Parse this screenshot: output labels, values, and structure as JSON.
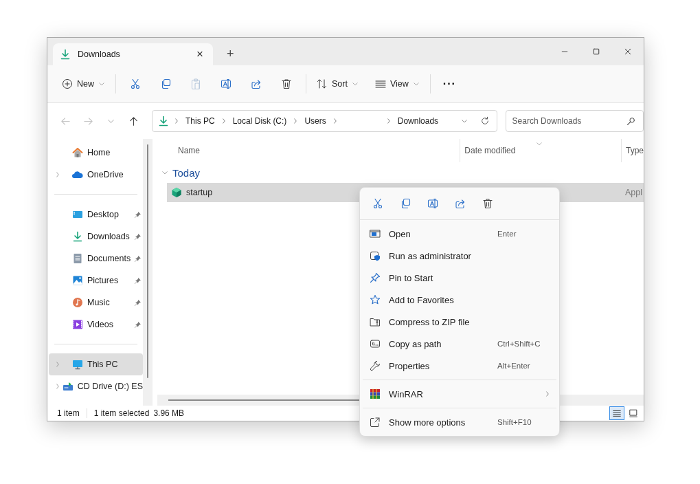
{
  "window": {
    "tab_title": "Downloads",
    "tab_close": "×",
    "new_tab": "+"
  },
  "toolbar": {
    "new_label": "New",
    "sort_label": "Sort",
    "view_label": "View",
    "more": "···",
    "actions": [
      {
        "kind": "cut",
        "disabled": false
      },
      {
        "kind": "copy",
        "disabled": false
      },
      {
        "kind": "paste",
        "disabled": true
      },
      {
        "kind": "rename",
        "disabled": false
      },
      {
        "kind": "share",
        "disabled": false
      },
      {
        "kind": "delete",
        "disabled": false
      }
    ]
  },
  "navigation": [
    {
      "kind": "back",
      "disabled": true
    },
    {
      "kind": "forward",
      "disabled": true
    },
    {
      "kind": "recent",
      "disabled": true
    },
    {
      "kind": "up",
      "disabled": false
    }
  ],
  "address": {
    "segments": [
      {
        "kind": "text",
        "label": "This PC"
      },
      {
        "kind": "text",
        "label": "Local Disk (C:)"
      },
      {
        "kind": "text",
        "label": "Users"
      },
      {
        "kind": "blank"
      },
      {
        "kind": "text",
        "label": "Downloads"
      }
    ]
  },
  "search": {
    "placeholder": "Search Downloads"
  },
  "sidebar": {
    "groups": [
      [
        {
          "label": "Home",
          "kind": "home",
          "pinned": false,
          "expandable": false,
          "selected": false
        },
        {
          "label": "OneDrive",
          "kind": "cloud",
          "pinned": false,
          "expandable": true,
          "selected": false
        }
      ],
      [
        {
          "label": "Desktop",
          "kind": "desktop",
          "pinned": true,
          "expandable": false,
          "selected": false
        },
        {
          "label": "Downloads",
          "kind": "download",
          "pinned": true,
          "expandable": false,
          "selected": false
        },
        {
          "label": "Documents",
          "kind": "document",
          "pinned": true,
          "expandable": false,
          "selected": false
        },
        {
          "label": "Pictures",
          "kind": "picture",
          "pinned": true,
          "expandable": false,
          "selected": false
        },
        {
          "label": "Music",
          "kind": "music",
          "pinned": true,
          "expandable": false,
          "selected": false
        },
        {
          "label": "Videos",
          "kind": "video",
          "pinned": true,
          "expandable": false,
          "selected": false
        }
      ],
      [
        {
          "label": "This PC",
          "kind": "pc",
          "pinned": false,
          "expandable": true,
          "selected": true
        },
        {
          "label": "CD Drive (D:) ES",
          "kind": "cd",
          "pinned": false,
          "expandable": true,
          "selected": false
        }
      ]
    ]
  },
  "file_list": {
    "columns": [
      "Name",
      "Date modified",
      "Type"
    ],
    "groups": [
      {
        "label": "Today",
        "expanded": true,
        "rows": [
          {
            "name": "startup",
            "type": "Appl",
            "selected": true
          }
        ]
      }
    ]
  },
  "status_bar": {
    "count": "1 item",
    "selection": "1 item selected",
    "size": "3.96 MB",
    "views": [
      {
        "kind": "details",
        "selected": true
      },
      {
        "kind": "tiles",
        "selected": false
      }
    ]
  },
  "context_menu": {
    "quick_actions": [
      {
        "kind": "cut"
      },
      {
        "kind": "copy"
      },
      {
        "kind": "rename"
      },
      {
        "kind": "share"
      },
      {
        "kind": "delete"
      }
    ],
    "groups": [
      [
        {
          "label": "Open",
          "kind": "open",
          "shortcut": "Enter",
          "submenu": false
        },
        {
          "label": "Run as administrator",
          "kind": "shield",
          "submenu": false
        },
        {
          "label": "Pin to Start",
          "kind": "pin",
          "submenu": false
        },
        {
          "label": "Add to Favorites",
          "kind": "star",
          "submenu": false
        },
        {
          "label": "Compress to ZIP file",
          "kind": "zip",
          "submenu": false
        },
        {
          "label": "Copy as path",
          "kind": "path",
          "shortcut": "Ctrl+Shift+C",
          "submenu": false
        },
        {
          "label": "Properties",
          "kind": "wrench",
          "shortcut": "Alt+Enter",
          "submenu": false
        }
      ],
      [
        {
          "label": "WinRAR",
          "kind": "winrar",
          "submenu": true
        }
      ],
      [
        {
          "label": "Show more options",
          "kind": "more",
          "shortcut": "Shift+F10",
          "submenu": false
        }
      ]
    ]
  }
}
